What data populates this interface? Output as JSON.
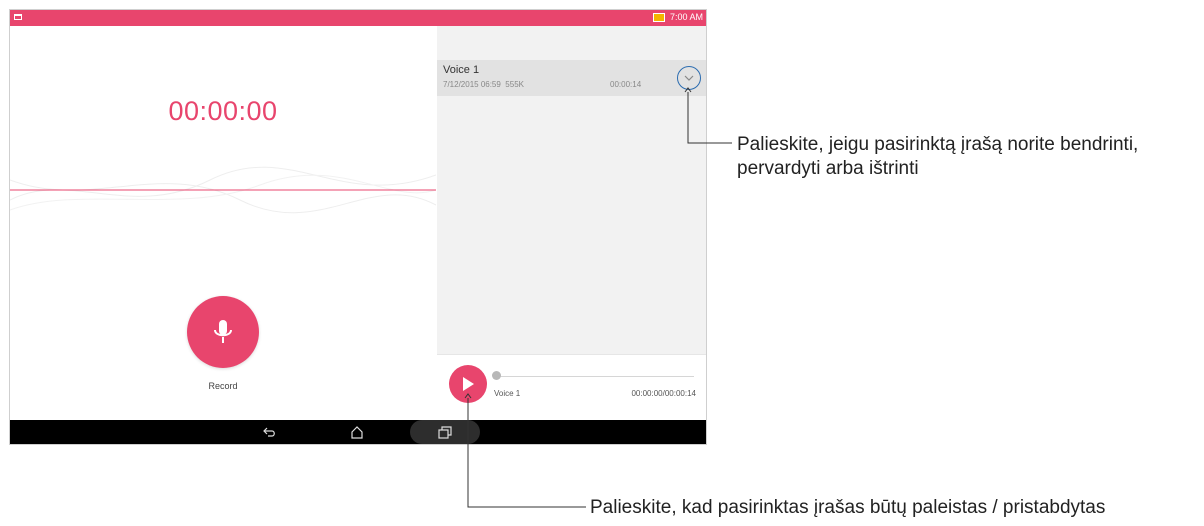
{
  "status_bar": {
    "time": "7:00 AM",
    "color": "#e8456d"
  },
  "recorder": {
    "timer": "00:00:00",
    "record_label": "Record",
    "accent_color": "#e8456d"
  },
  "recordings": [
    {
      "title": "Voice 1",
      "date": "7/12/2015 06:59",
      "size": "555K",
      "duration": "00:00:14"
    }
  ],
  "player": {
    "title": "Voice 1",
    "time": "00:00:00/00:00:14",
    "progress": 0
  },
  "icons": {
    "overflow": "more-vertical-icon",
    "expand": "chevron-down-icon",
    "play": "play-icon",
    "record": "microphone-icon",
    "nav": [
      "back-icon",
      "home-icon",
      "recent-apps-icon"
    ]
  },
  "annotations": {
    "expand_callout": "Palieskite, jeigu pasirinktą įrašą norite bendrinti, pervardyti arba ištrinti",
    "play_callout": "Palieskite, kad pasirinktas įrašas būtų paleistas / pristabdytas"
  }
}
